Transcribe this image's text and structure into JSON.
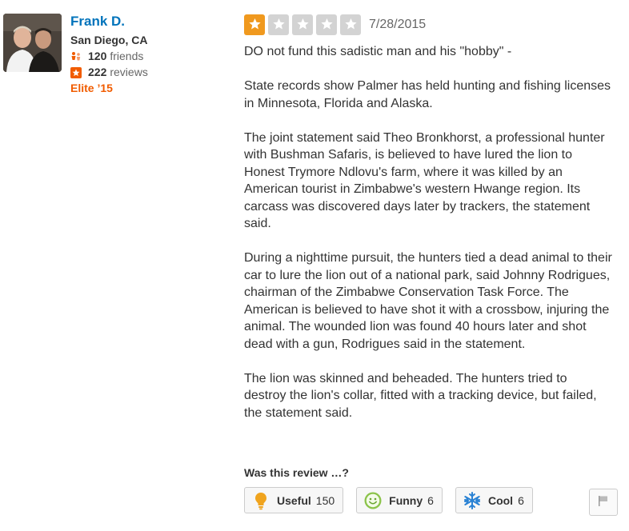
{
  "user": {
    "name": "Frank D.",
    "location": "San Diego, CA",
    "friends_count": "120",
    "friends_label": "friends",
    "reviews_count": "222",
    "reviews_label": "reviews",
    "elite": "Elite ’15"
  },
  "review": {
    "rating": 1,
    "rating_max": 5,
    "date": "7/28/2015",
    "paragraphs": [
      "DO not fund this sadistic man and his \"hobby\" -",
      "State records show Palmer has held hunting and fishing licenses in Minnesota, Florida and Alaska.",
      "The joint statement said Theo Bronkhorst, a professional hunter with Bushman Safaris, is believed to have lured the lion to Honest Trymore Ndlovu's farm, where it was killed by an American tourist in Zimbabwe's western Hwange region. Its carcass was discovered days later by trackers, the statement said.",
      "During a nighttime pursuit, the hunters tied a dead animal to their car to lure the lion out of a national park, said Johnny Rodrigues, chairman of the Zimbabwe Conservation Task Force. The American is believed to have shot it with a crossbow, injuring the animal. The wounded lion was found 40 hours later and shot dead with a gun, Rodrigues said in the statement.",
      "The lion was skinned and beheaded. The hunters tried to destroy the lion's collar, fitted with a tracking device, but failed, the statement said."
    ]
  },
  "feedback": {
    "prompt": "Was this review …?",
    "useful_label": "Useful",
    "useful_count": "150",
    "funny_label": "Funny",
    "funny_count": "6",
    "cool_label": "Cool",
    "cool_count": "6"
  },
  "icons": {
    "friends": "friends-icon",
    "reviews": "star-badge-icon",
    "useful": "lightbulb-icon",
    "funny": "smiley-icon",
    "cool": "snowflake-icon",
    "flag": "flag-icon"
  },
  "colors": {
    "link": "#0073bb",
    "elite": "#f15c00",
    "star_on": "#f0991e",
    "star_off": "#d3d3d3"
  }
}
